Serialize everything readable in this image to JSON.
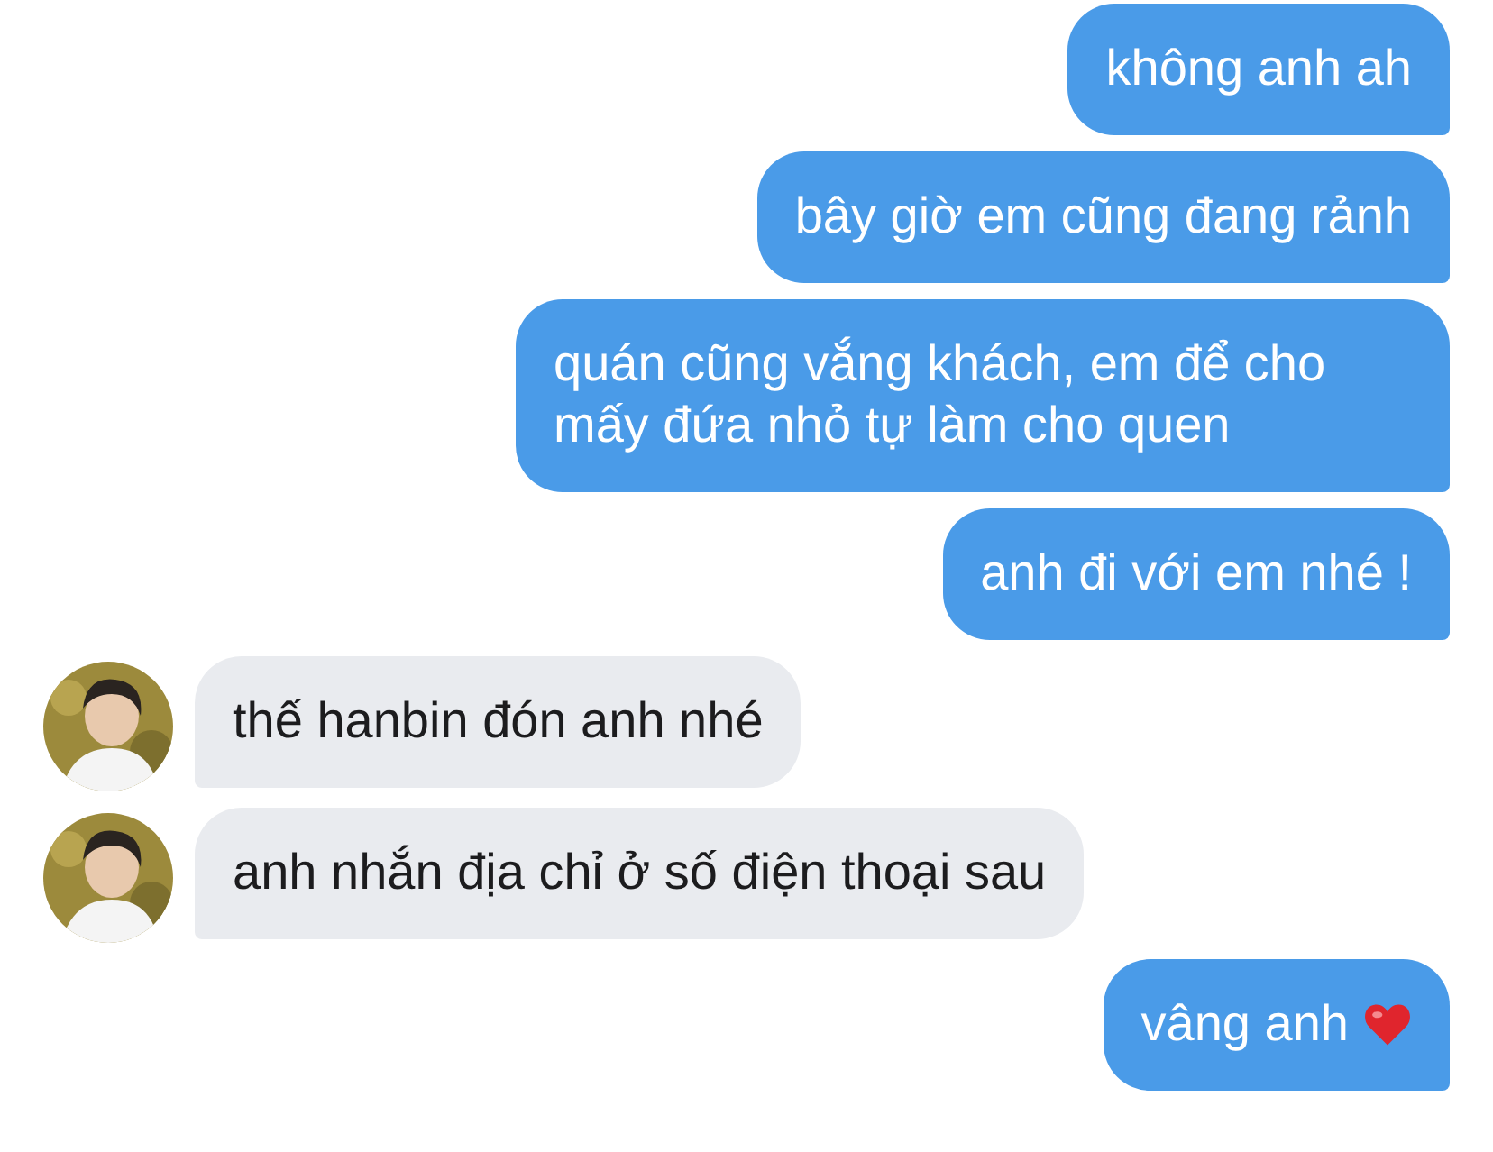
{
  "messages": [
    {
      "kind": "outgoing",
      "text": "không anh ah",
      "heart": false
    },
    {
      "kind": "outgoing",
      "text": "bây giờ em cũng đang rảnh",
      "heart": false
    },
    {
      "kind": "outgoing",
      "text": "quán cũng vắng khách, em để cho mấy đứa nhỏ tự làm cho quen",
      "heart": false
    },
    {
      "kind": "outgoing",
      "text": "anh đi với em nhé !",
      "heart": false
    },
    {
      "kind": "incoming",
      "text": "thế hanbin đón anh nhé",
      "heart": false
    },
    {
      "kind": "incoming",
      "text": "anh nhắn địa chỉ ở số điện thoại sau",
      "heart": false
    },
    {
      "kind": "outgoing",
      "text": "vâng anh",
      "heart": true
    }
  ]
}
